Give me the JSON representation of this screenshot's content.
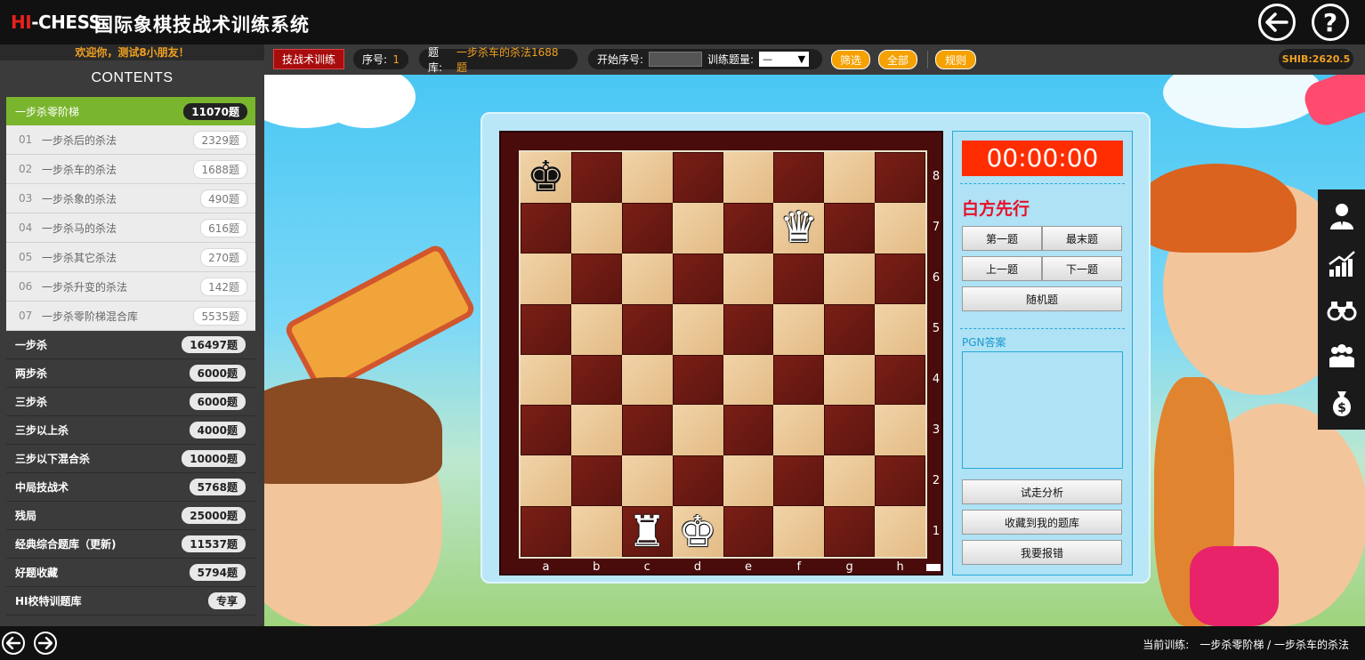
{
  "header": {
    "logo_hi": "HI",
    "logo_chess": "-CHESS",
    "title": "国际象棋技战术训练系统"
  },
  "sidebar": {
    "welcome": "欢迎你，测试8小朋友！",
    "contents_title": "CONTENTS",
    "active": {
      "label": "一步杀零阶梯",
      "count": "11070题"
    },
    "sub_items": [
      {
        "num": "01",
        "label": "一步杀后的杀法",
        "count": "2329题"
      },
      {
        "num": "02",
        "label": "一步杀车的杀法",
        "count": "1688题"
      },
      {
        "num": "03",
        "label": "一步杀象的杀法",
        "count": "490题"
      },
      {
        "num": "04",
        "label": "一步杀马的杀法",
        "count": "616题"
      },
      {
        "num": "05",
        "label": "一步杀其它杀法",
        "count": "270题"
      },
      {
        "num": "06",
        "label": "一步杀升变的杀法",
        "count": "142题"
      },
      {
        "num": "07",
        "label": "一步杀零阶梯混合库",
        "count": "5535题"
      }
    ],
    "categories": [
      {
        "label": "一步杀",
        "count": "16497题"
      },
      {
        "label": "两步杀",
        "count": "6000题"
      },
      {
        "label": "三步杀",
        "count": "6000题"
      },
      {
        "label": "三步以上杀",
        "count": "4000题"
      },
      {
        "label": "三步以下混合杀",
        "count": "10000题"
      },
      {
        "label": "中局技战术",
        "count": "5768题"
      },
      {
        "label": "残局",
        "count": "25000题"
      },
      {
        "label": "经典综合题库（更新)",
        "count": "11537题"
      },
      {
        "label": "好题收藏",
        "count": "5794题"
      },
      {
        "label": "HI校特训题库",
        "count": "专享"
      }
    ]
  },
  "toolbar": {
    "mode": "技战术训练",
    "seq_label": "序号:",
    "seq_value": "1",
    "bank_label": "题库:",
    "bank_value": "一步杀车的杀法1688题",
    "start_label": "开始序号:",
    "count_label": "训练题量:",
    "count_select": "—",
    "filter": "筛选",
    "all": "全部",
    "rules": "规则",
    "shib": "SHIB:2620.5"
  },
  "board": {
    "files": [
      "a",
      "b",
      "c",
      "d",
      "e",
      "f",
      "g",
      "h"
    ],
    "ranks": [
      "8",
      "7",
      "6",
      "5",
      "4",
      "3",
      "2",
      "1"
    ],
    "pieces": [
      {
        "square": "a8",
        "glyph": "♚",
        "color": "black",
        "name": "black-king"
      },
      {
        "square": "f7",
        "glyph": "♛",
        "color": "white",
        "name": "white-queen"
      },
      {
        "square": "c1",
        "glyph": "♜",
        "color": "white",
        "name": "white-rook"
      },
      {
        "square": "d1",
        "glyph": "♚",
        "color": "white",
        "name": "white-king"
      }
    ]
  },
  "controls": {
    "timer": "00:00:00",
    "turn": "白方先行",
    "first": "第一题",
    "last": "最末题",
    "prev": "上一题",
    "next": "下一题",
    "random": "随机题",
    "pgn_label": "PGN答案",
    "analyze": "试走分析",
    "collect": "收藏到我的题库",
    "report": "我要报错"
  },
  "rail_icons": [
    "user-icon",
    "chart-icon",
    "binoculars-icon",
    "group-icon",
    "money-bag-icon"
  ],
  "footer": {
    "label": "当前训练:",
    "path": "一步杀零阶梯 / 一步杀车的杀法"
  }
}
